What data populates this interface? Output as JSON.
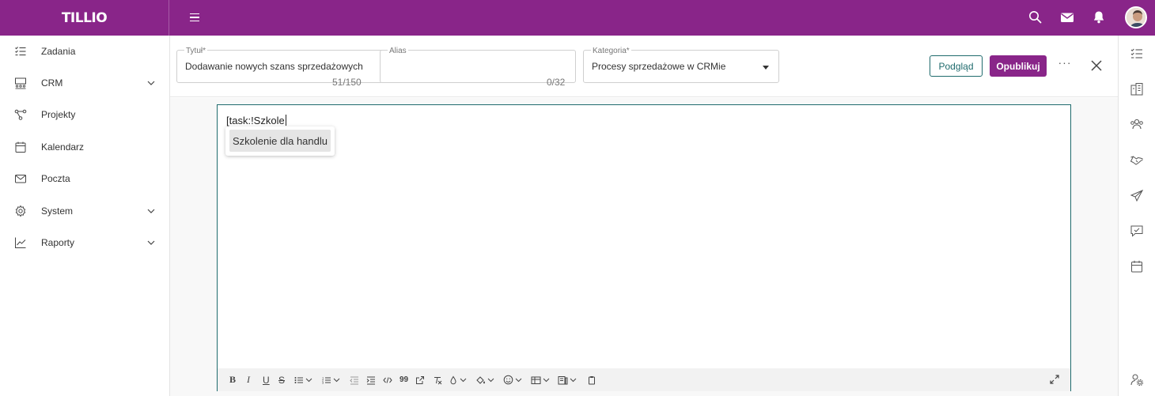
{
  "app": {
    "logo": "TILLIO"
  },
  "topbar": {
    "icons": [
      "hamburger-icon",
      "search-icon",
      "mail-icon",
      "bell-icon",
      "avatar"
    ],
    "accent_color": "#892589"
  },
  "sidebar": {
    "items": [
      {
        "label": "Zadania",
        "icon": "tasks-icon",
        "has_chevron": false
      },
      {
        "label": "CRM",
        "icon": "crm-icon",
        "has_chevron": true
      },
      {
        "label": "Projekty",
        "icon": "projects-icon",
        "has_chevron": false
      },
      {
        "label": "Kalendarz",
        "icon": "calendar-icon",
        "has_chevron": false
      },
      {
        "label": "Poczta",
        "icon": "mail-icon",
        "has_chevron": false
      },
      {
        "label": "System",
        "icon": "gear-icon",
        "has_chevron": true
      },
      {
        "label": "Raporty",
        "icon": "chart-icon",
        "has_chevron": true
      }
    ]
  },
  "form": {
    "title_field": {
      "label": "Tytuł*",
      "value": "Dodawanie nowych szans sprzedażowych",
      "counter": "51/150"
    },
    "alias_field": {
      "label": "Alias",
      "value": "",
      "counter": "0/32"
    },
    "category_field": {
      "label": "Kategoria*",
      "value": "Procesy sprzedażowe w CRMie"
    },
    "preview_button": "Podgląd",
    "publish_button": "Opublikuj",
    "more_button": "···"
  },
  "editor": {
    "text": "[task:!Szkole",
    "suggestion": "Szkolenie dla handlu",
    "toolbar": [
      "bold",
      "italic",
      "underline",
      "strikethrough",
      "bullet-list",
      "numbered-list",
      "outdent",
      "indent",
      "code",
      "blockquote",
      "link",
      "clear-format",
      "text-color",
      "background-color",
      "emoji",
      "table",
      "template",
      "paste",
      "fullscreen"
    ],
    "toolbar_labels": {
      "bold": "B",
      "italic": "I",
      "underline": "U",
      "strike": "S",
      "quote": "99"
    }
  },
  "right_rail": {
    "icons": [
      "tasks-icon",
      "building-icon",
      "contacts-icon",
      "handshake-icon",
      "send-icon",
      "chat-check-icon",
      "calendar-icon",
      "settings-person-icon"
    ]
  }
}
